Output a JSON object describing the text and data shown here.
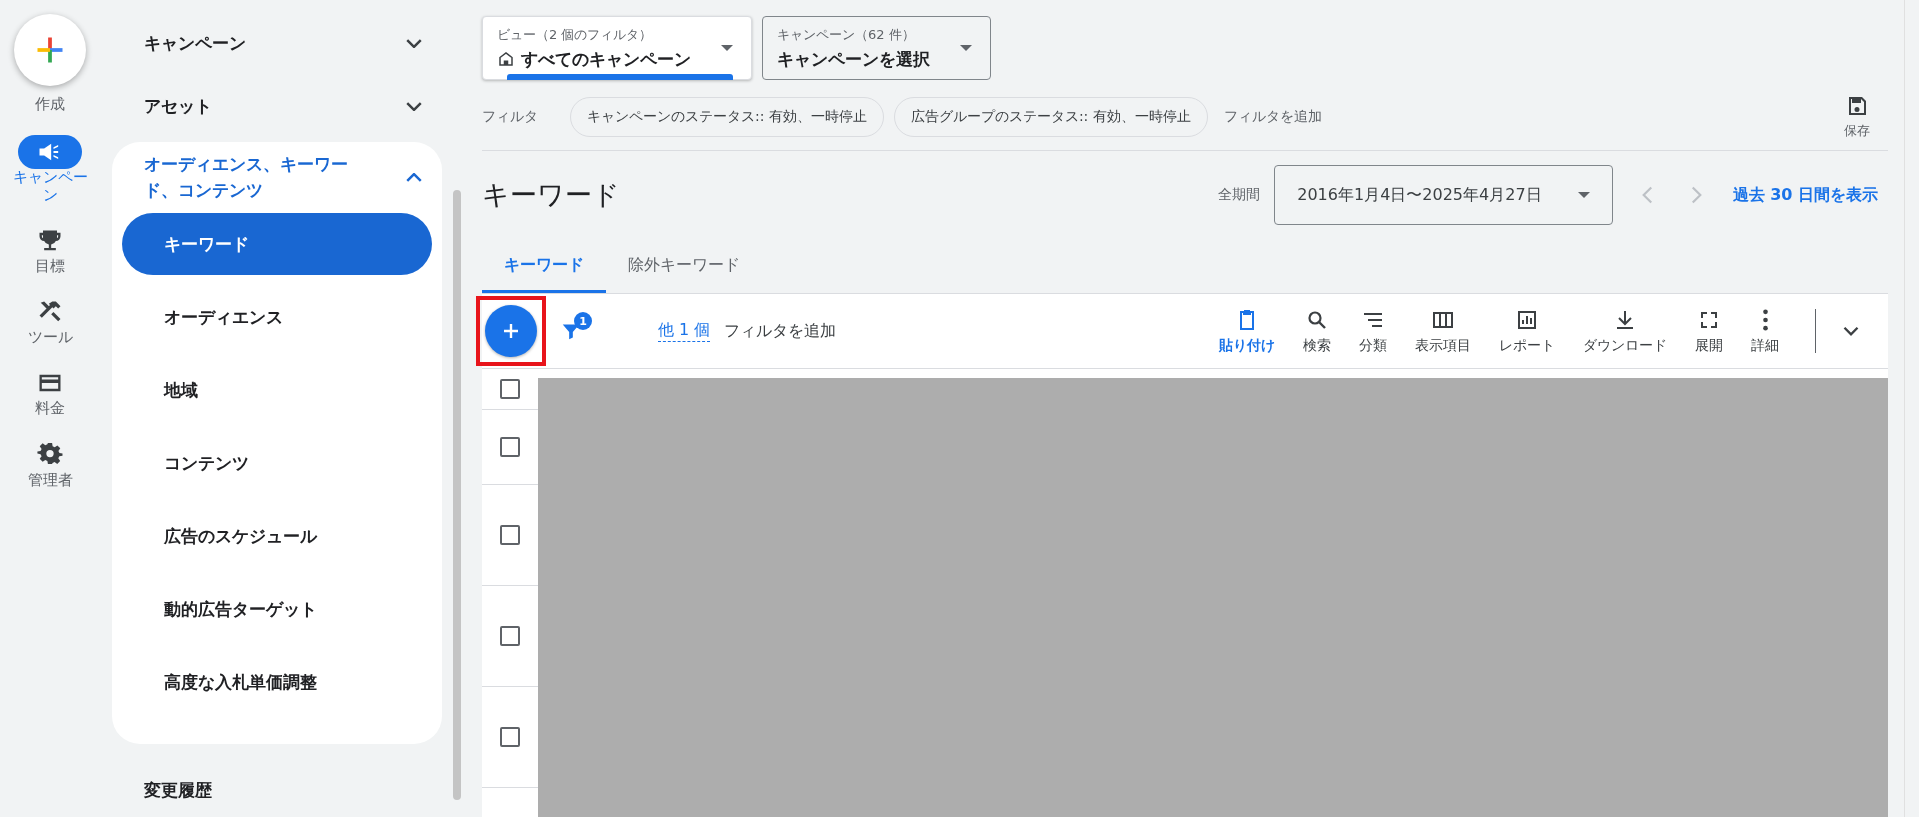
{
  "rail": {
    "create_label": "作成",
    "items": [
      {
        "label": "キャンペーン",
        "selected": true
      },
      {
        "label": "目標",
        "selected": false
      },
      {
        "label": "ツール",
        "selected": false
      },
      {
        "label": "料金",
        "selected": false
      },
      {
        "label": "管理者",
        "selected": false
      }
    ]
  },
  "nav": {
    "sections": [
      {
        "label": "キャンペーン",
        "expanded": false
      },
      {
        "label": "アセット",
        "expanded": false
      },
      {
        "label": "オーディエンス、キーワード、コンテンツ",
        "expanded": true,
        "children": [
          {
            "label": "キーワード",
            "selected": true
          },
          {
            "label": "オーディエンス",
            "selected": false
          },
          {
            "label": "地域",
            "selected": false
          },
          {
            "label": "コンテンツ",
            "selected": false
          },
          {
            "label": "広告のスケジュール",
            "selected": false
          },
          {
            "label": "動的広告ターゲット",
            "selected": false
          },
          {
            "label": "高度な入札単価調整",
            "selected": false
          }
        ]
      }
    ],
    "footer_item": "変更履歴"
  },
  "view_picker": {
    "label": "ビュー（2 個のフィルタ）",
    "value": "すべてのキャンペーン"
  },
  "campaign_picker": {
    "label": "キャンペーン（62 件）",
    "value": "キャンペーンを選択"
  },
  "filters": {
    "label": "フィルタ",
    "chips": [
      "キャンペーンのステータス:: 有効、一時停止",
      "広告グループのステータス:: 有効、一時停止"
    ],
    "add": "フィルタを追加",
    "save": "保存"
  },
  "page_title": "キーワード",
  "date": {
    "label": "全期間",
    "range": "2016年1月4日〜2025年4月27日",
    "link": "過去 30 日間を表示"
  },
  "tabs": [
    {
      "label": "キーワード",
      "selected": true
    },
    {
      "label": "除外キーワード",
      "selected": false
    }
  ],
  "toolbar": {
    "add_highlighted": true,
    "filter_badge": "1",
    "more_filters": "他 1 個",
    "add_filter": "フィルタを追加",
    "actions": [
      {
        "label": "貼り付け",
        "primary": true
      },
      {
        "label": "検索",
        "primary": false
      },
      {
        "label": "分類",
        "primary": false
      },
      {
        "label": "表示項目",
        "primary": false
      },
      {
        "label": "レポート",
        "primary": false
      },
      {
        "label": "ダウンロード",
        "primary": false
      },
      {
        "label": "展開",
        "primary": false
      },
      {
        "label": "詳細",
        "primary": false
      }
    ]
  },
  "table": {
    "rows": [
      {
        "checked": false
      },
      {
        "checked": false
      },
      {
        "checked": false
      },
      {
        "checked": false
      },
      {
        "checked": false
      }
    ]
  }
}
